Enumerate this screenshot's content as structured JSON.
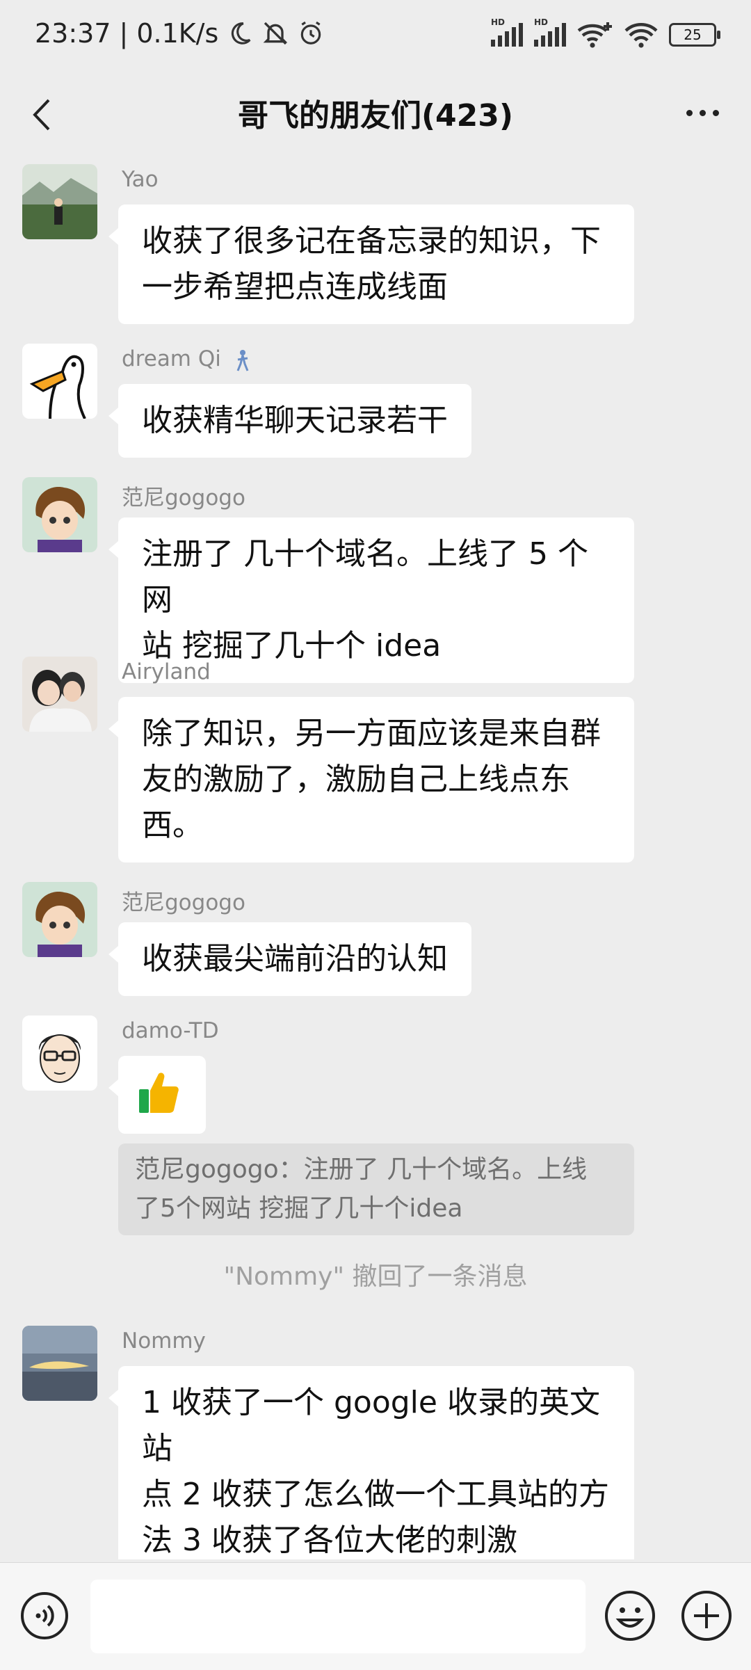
{
  "status_bar": {
    "time": "23:37",
    "separator": "|",
    "net_speed": "0.1K/s",
    "signal_label": "HD",
    "battery": "25"
  },
  "nav": {
    "title": "哥飞的朋友们(423)"
  },
  "messages": [
    {
      "sender": "Yao",
      "text": [
        "收获了很多记在备忘录的知识，下",
        "一步希望把点连成线面"
      ]
    },
    {
      "sender": "dream Qi",
      "text": [
        "收获精华聊天记录若干"
      ]
    },
    {
      "sender": "范尼gogogo",
      "text": [
        "注册了 几十个域名。上线了 5 个网",
        "站 挖掘了几十个 idea"
      ]
    },
    {
      "sender": "Airyland",
      "text": [
        "除了知识，另一方面应该是来自群",
        "友的激励了，激励自己上线点东",
        "西。"
      ]
    },
    {
      "sender": "范尼gogogo",
      "text": [
        "收获最尖端前沿的认知"
      ]
    },
    {
      "sender": "damo-TD",
      "emoji": "👍",
      "quote": [
        "范尼gogogo：注册了 几十个域名。上线",
        "了5个网站 挖掘了几十个idea"
      ]
    },
    {
      "sender": "Nommy",
      "text": [
        "1 收获了一个 google 收录的英文站",
        "点 2 收获了怎么做一个工具站的方",
        "法 3 收获了各位大佬的刺激"
      ]
    }
  ],
  "system_notice": "\"Nommy\" 撤回了一条消息",
  "icons": {
    "back": "chevron-left-icon",
    "more": "more-dots-icon",
    "voice": "voice-icon",
    "emoji": "emoji-icon",
    "plus": "plus-icon"
  },
  "colors": {
    "background": "#ededed",
    "bubble": "#ffffff",
    "quote": "#dedede"
  }
}
